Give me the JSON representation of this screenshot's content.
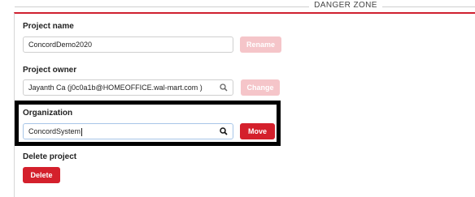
{
  "danger_zone": {
    "title": "DANGER ZONE"
  },
  "project_name": {
    "label": "Project name",
    "value": "ConcordDemo2020",
    "button": "Rename"
  },
  "project_owner": {
    "label": "Project owner",
    "value": "Jayanth Ca (j0c0a1b@HOMEOFFICE.wal-mart.com )",
    "button": "Change",
    "icon": "search-icon"
  },
  "organization": {
    "label": "Organization",
    "value": "ConcordSystem",
    "button": "Move",
    "icon": "search-icon"
  },
  "delete_project": {
    "label": "Delete project",
    "button": "Delete"
  },
  "colors": {
    "accent": "#d4202c",
    "accent_disabled": "#f5c5c9",
    "highlight_border": "#000000"
  }
}
